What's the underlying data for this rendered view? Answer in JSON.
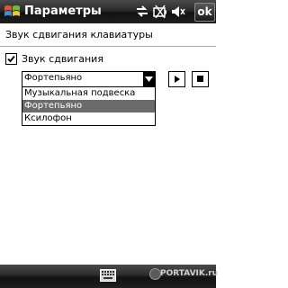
{
  "titlebar": {
    "app_title": "Параметры",
    "ok_label": "ok",
    "icons": [
      "start-logo",
      "connectivity-icon",
      "battery-icon",
      "volume-icon"
    ]
  },
  "section": {
    "header": "Звук сдвигания клавиатуры"
  },
  "sound": {
    "checkbox_label": "Звук сдвигания",
    "checked": true
  },
  "dropdown": {
    "selected": "Фортепьяно",
    "options": [
      "Музыкальная подвеска",
      "Фортепьяно",
      "Ксилофон"
    ],
    "highlighted_index": 1
  },
  "buttons": {
    "play": "play-icon",
    "stop": "stop-icon"
  },
  "bottombar": {
    "keyboard": "keyboard-icon",
    "watermark": "PORTAVIK.ru"
  },
  "colors": {
    "bar_dark": "#1e1e1e",
    "selection": "#6b6b6b",
    "separator": "#a9a9a9"
  }
}
